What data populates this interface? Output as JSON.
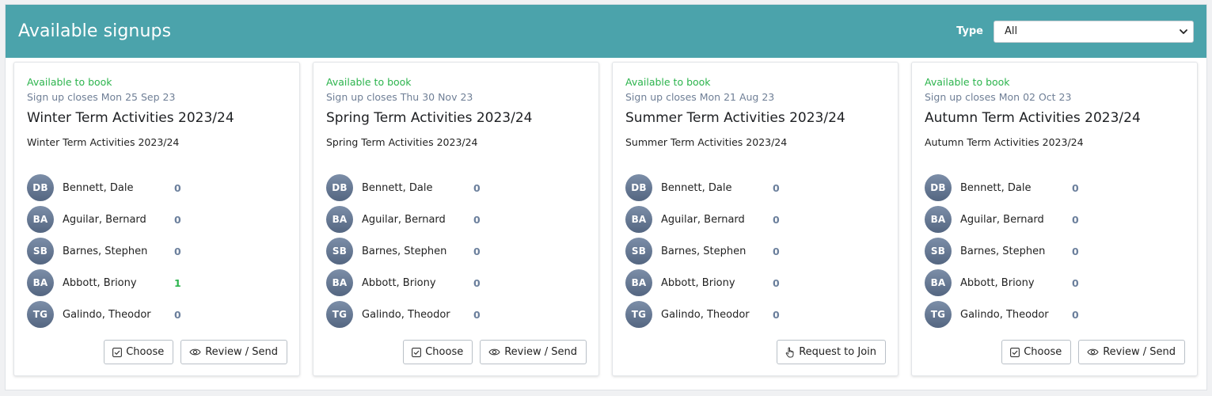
{
  "header": {
    "title": "Available signups",
    "type_label": "Type",
    "type_selected": "All"
  },
  "cards": [
    {
      "status": "Available to book",
      "closes": "Sign up closes Mon 25 Sep 23",
      "title": "Winter Term Activities 2023/24",
      "subtitle": "Winter Term Activities 2023/24",
      "members": [
        {
          "initials": "DB",
          "name": "Bennett, Dale",
          "count": "0"
        },
        {
          "initials": "BA",
          "name": "Aguilar, Bernard",
          "count": "0"
        },
        {
          "initials": "SB",
          "name": "Barnes, Stephen",
          "count": "0"
        },
        {
          "initials": "BA",
          "name": "Abbott, Briony",
          "count": "1"
        },
        {
          "initials": "TG",
          "name": "Galindo, Theodor",
          "count": "0"
        }
      ],
      "choose_label": "Choose",
      "review_label": "Review / Send"
    },
    {
      "status": "Available to book",
      "closes": "Sign up closes Thu 30 Nov 23",
      "title": "Spring Term Activities 2023/24",
      "subtitle": "Spring Term Activities 2023/24",
      "members": [
        {
          "initials": "DB",
          "name": "Bennett, Dale",
          "count": "0"
        },
        {
          "initials": "BA",
          "name": "Aguilar, Bernard",
          "count": "0"
        },
        {
          "initials": "SB",
          "name": "Barnes, Stephen",
          "count": "0"
        },
        {
          "initials": "BA",
          "name": "Abbott, Briony",
          "count": "0"
        },
        {
          "initials": "TG",
          "name": "Galindo, Theodor",
          "count": "0"
        }
      ],
      "choose_label": "Choose",
      "review_label": "Review / Send"
    },
    {
      "status": "Available to book",
      "closes": "Sign up closes Mon 21 Aug 23",
      "title": "Summer Term Activities 2023/24",
      "subtitle": "Summer Term Activities 2023/24",
      "members": [
        {
          "initials": "DB",
          "name": "Bennett, Dale",
          "count": "0"
        },
        {
          "initials": "BA",
          "name": "Aguilar, Bernard",
          "count": "0"
        },
        {
          "initials": "SB",
          "name": "Barnes, Stephen",
          "count": "0"
        },
        {
          "initials": "BA",
          "name": "Abbott, Briony",
          "count": "0"
        },
        {
          "initials": "TG",
          "name": "Galindo, Theodor",
          "count": "0"
        }
      ],
      "request_label": "Request to Join"
    },
    {
      "status": "Available to book",
      "closes": "Sign up closes Mon 02 Oct 23",
      "title": "Autumn Term Activities 2023/24",
      "subtitle": "Autumn Term Activities 2023/24",
      "members": [
        {
          "initials": "DB",
          "name": "Bennett, Dale",
          "count": "0"
        },
        {
          "initials": "BA",
          "name": "Aguilar, Bernard",
          "count": "0"
        },
        {
          "initials": "SB",
          "name": "Barnes, Stephen",
          "count": "0"
        },
        {
          "initials": "BA",
          "name": "Abbott, Briony",
          "count": "0"
        },
        {
          "initials": "TG",
          "name": "Galindo, Theodor",
          "count": "0"
        }
      ],
      "choose_label": "Choose",
      "review_label": "Review / Send"
    }
  ],
  "colors": {
    "header_bg": "#4ba3ab",
    "status_green": "#2cb44d",
    "muted_blue": "#6f7f96",
    "avatar": "#627491"
  },
  "icons": {
    "choose": "check-square-icon",
    "review": "eye-icon",
    "request": "hand-pointer-icon",
    "select": "chevron-down-icon"
  }
}
